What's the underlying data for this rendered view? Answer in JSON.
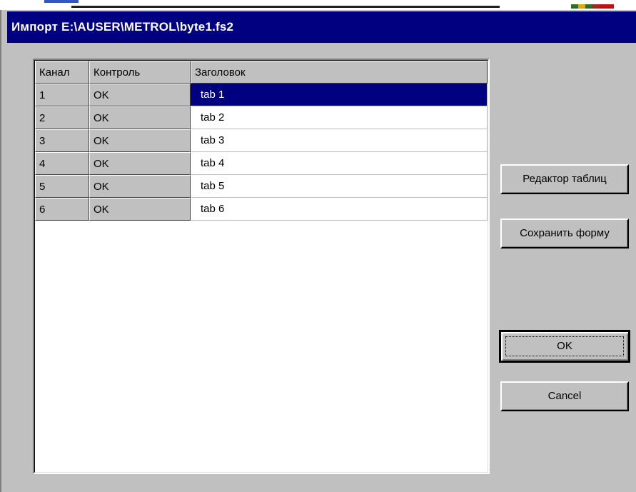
{
  "window": {
    "title": "Импорт E:\\AUSER\\METROL\\byte1.fs2"
  },
  "grid": {
    "headers": [
      "Канал",
      "Контроль",
      "Заголовок"
    ],
    "rows": [
      {
        "channel": "1",
        "control": "OK",
        "title": "tab 1",
        "selected": true
      },
      {
        "channel": "2",
        "control": "OK",
        "title": "tab 2",
        "selected": false
      },
      {
        "channel": "3",
        "control": "OK",
        "title": "tab 3",
        "selected": false
      },
      {
        "channel": "4",
        "control": "OK",
        "title": "tab 4",
        "selected": false
      },
      {
        "channel": "5",
        "control": "OK",
        "title": "tab 5",
        "selected": false
      },
      {
        "channel": "6",
        "control": "OK",
        "title": "tab 6",
        "selected": false
      }
    ]
  },
  "buttons": {
    "table_editor": "Редактор таблиц",
    "save_form": "Сохранить форму",
    "ok": "OK",
    "cancel": "Cancel"
  },
  "colors": {
    "titlebar": "#000080",
    "selection": "#000080",
    "face": "#c0c0c0"
  }
}
